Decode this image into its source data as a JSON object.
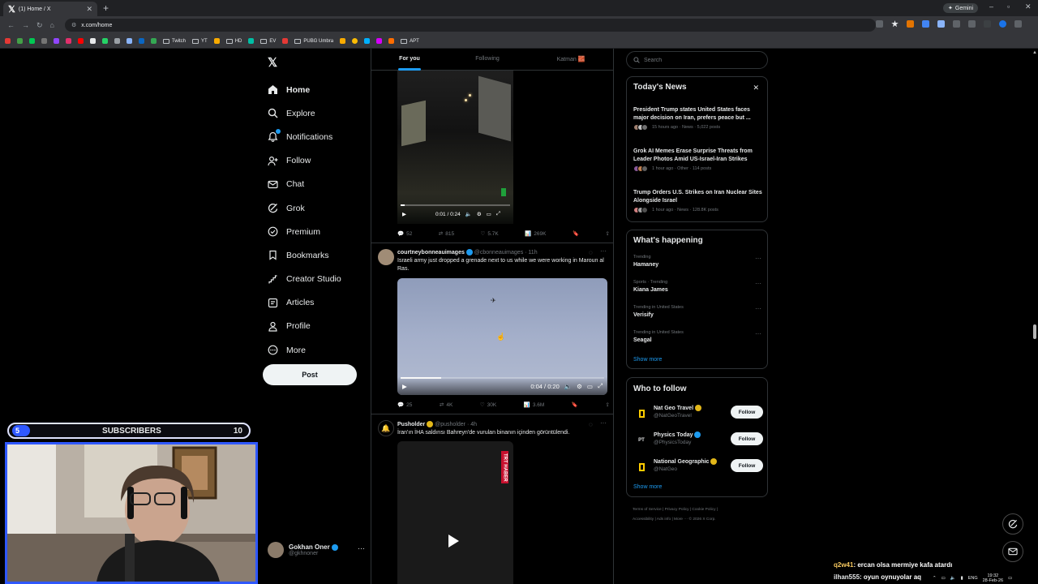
{
  "browser": {
    "tab_title": "(1) Home / X",
    "url": "x.com/home",
    "gemini": "Gemini",
    "bookmarks": [
      "Twitch",
      "YT",
      "HD",
      "EV",
      "PUBG Umbra",
      "APT"
    ]
  },
  "sidebar": {
    "items": [
      {
        "label": "Home",
        "icon": "home-icon"
      },
      {
        "label": "Explore",
        "icon": "search-icon"
      },
      {
        "label": "Notifications",
        "icon": "bell-icon"
      },
      {
        "label": "Follow",
        "icon": "person-add-icon"
      },
      {
        "label": "Chat",
        "icon": "mail-icon"
      },
      {
        "label": "Grok",
        "icon": "grok-icon"
      },
      {
        "label": "Premium",
        "icon": "premium-icon"
      },
      {
        "label": "Bookmarks",
        "icon": "bookmark-icon"
      },
      {
        "label": "Creator Studio",
        "icon": "creator-studio-icon"
      },
      {
        "label": "Articles",
        "icon": "articles-icon"
      },
      {
        "label": "Profile",
        "icon": "person-icon"
      },
      {
        "label": "More",
        "icon": "more-circle-icon"
      }
    ],
    "post_label": "Post",
    "account": {
      "name": "Gokhan Oner",
      "handle": "@gkhnoner"
    }
  },
  "feed": {
    "tabs": [
      "For you",
      "Following",
      "Katman 🧱"
    ],
    "post1": {
      "time": "0:01 / 0:24",
      "stats": {
        "replies": "52",
        "reposts": "815",
        "likes": "5.7K",
        "views": "269K"
      }
    },
    "post2": {
      "name": "courtneybonneauimages",
      "handle": "@cbonneauimages",
      "age": "· 11h",
      "text": "Israeli army just dropped a grenade next to us while we were working in Maroun al Ras.",
      "time": "0:04 / 0:20",
      "stats": {
        "replies": "25",
        "reposts": "4K",
        "likes": "30K",
        "views": "3.6M"
      }
    },
    "post3": {
      "name": "Pusholder",
      "handle": "@pusholder",
      "age": "· 4h",
      "text": "İran'ın İHA saldırısı Bahreyn'de vurulan binanın içinden görüntülendi.",
      "badge": "TRT HABER"
    }
  },
  "right": {
    "search_placeholder": "Search",
    "todays_news": {
      "title": "Today's News",
      "items": [
        {
          "headline": "President Trump states United States faces major decision on Iran, prefers peace but ...",
          "meta": "15 hours ago · News · 5,022 posts"
        },
        {
          "headline": "Grok AI Memes Erase Surprise Threats from Leader Photos Amid US-Israel-Iran Strikes",
          "meta": "1 hour ago · Other · 114 posts"
        },
        {
          "headline": "Trump Orders U.S. Strikes on Iran Nuclear Sites Alongside Israel",
          "meta": "1 hour ago · News · 128.8K posts"
        }
      ]
    },
    "happening": {
      "title": "What's happening",
      "trends": [
        {
          "category": "Trending",
          "name": "Hamaney"
        },
        {
          "category": "Sports · Trending",
          "name": "Kiana James"
        },
        {
          "category": "Trending in United States",
          "name": "Verisify"
        },
        {
          "category": "Trending in United States",
          "name": "Seagal"
        }
      ],
      "show_more": "Show more"
    },
    "who_to_follow": {
      "title": "Who to follow",
      "accounts": [
        {
          "name": "Nat Geo Travel",
          "handle": "@NatGeoTravel"
        },
        {
          "name": "Physics Today",
          "handle": "@PhysicsToday"
        },
        {
          "name": "National Geographic",
          "handle": "@NatGeo"
        }
      ],
      "follow_label": "Follow",
      "show_more": "Show more"
    },
    "footer": [
      "Terms of Service",
      "Privacy Policy",
      "Cookie Policy",
      "Accessibility",
      "Ads info",
      "More ···",
      "© 2026 X Corp."
    ]
  },
  "overlay": {
    "subs_current": "5",
    "subs_label": "SUBSCRIBERS",
    "subs_goal": "10",
    "chat": [
      {
        "user": "q2w41",
        "text": ": ercan olsa mermiye kafa atardı"
      },
      {
        "user": "ilhan555",
        "text": ": oyun oynuyolar aq"
      }
    ]
  },
  "system": {
    "lang": "ENG",
    "time": "19:32",
    "date": "28-Feb-26"
  },
  "colors": {
    "accent": "#1d9bf0",
    "background": "#000000",
    "border": "#2f3336",
    "muted": "#71767b",
    "webcam_frame": "#2f58ff"
  }
}
